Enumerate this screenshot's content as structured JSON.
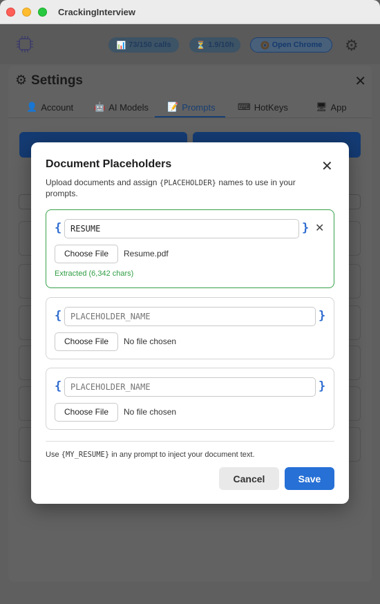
{
  "window": {
    "title": "CrackingInterview"
  },
  "header": {
    "calls_badge": "73/150 calls",
    "rate_badge": "1.9/10h",
    "chrome_button": "Open Chrome"
  },
  "settings": {
    "title": "Settings",
    "tabs": [
      {
        "label": "Account",
        "icon": "user-icon"
      },
      {
        "label": "AI Models",
        "icon": "robot-icon"
      },
      {
        "label": "Prompts",
        "icon": "memo-icon"
      },
      {
        "label": "HotKeys",
        "icon": "keyboard-icon"
      },
      {
        "label": "App",
        "icon": "monitor-icon"
      }
    ],
    "active_tab": "Prompts"
  },
  "modal": {
    "title": "Document Placeholders",
    "description_before": "Upload documents and assign",
    "description_code": "{PLACEHOLDER}",
    "description_after": "names to use in your prompts.",
    "placeholder_hint": "PLACEHOLDER_NAME",
    "choose_file_label": "Choose File",
    "cards": [
      {
        "name": "RESUME",
        "file": "Resume.pdf",
        "status": "Extracted (6,342 chars)"
      },
      {
        "name": "",
        "file": "No file chosen"
      },
      {
        "name": "",
        "file": "No file chosen"
      }
    ],
    "footer_before": "Use",
    "footer_code": "{MY_RESUME}",
    "footer_after": "in any prompt to inject your document text.",
    "cancel_label": "Cancel",
    "save_label": "Save"
  },
  "colors": {
    "accent": "#2670d6",
    "success": "#2f9d42",
    "brace": "#2d6bd0"
  }
}
